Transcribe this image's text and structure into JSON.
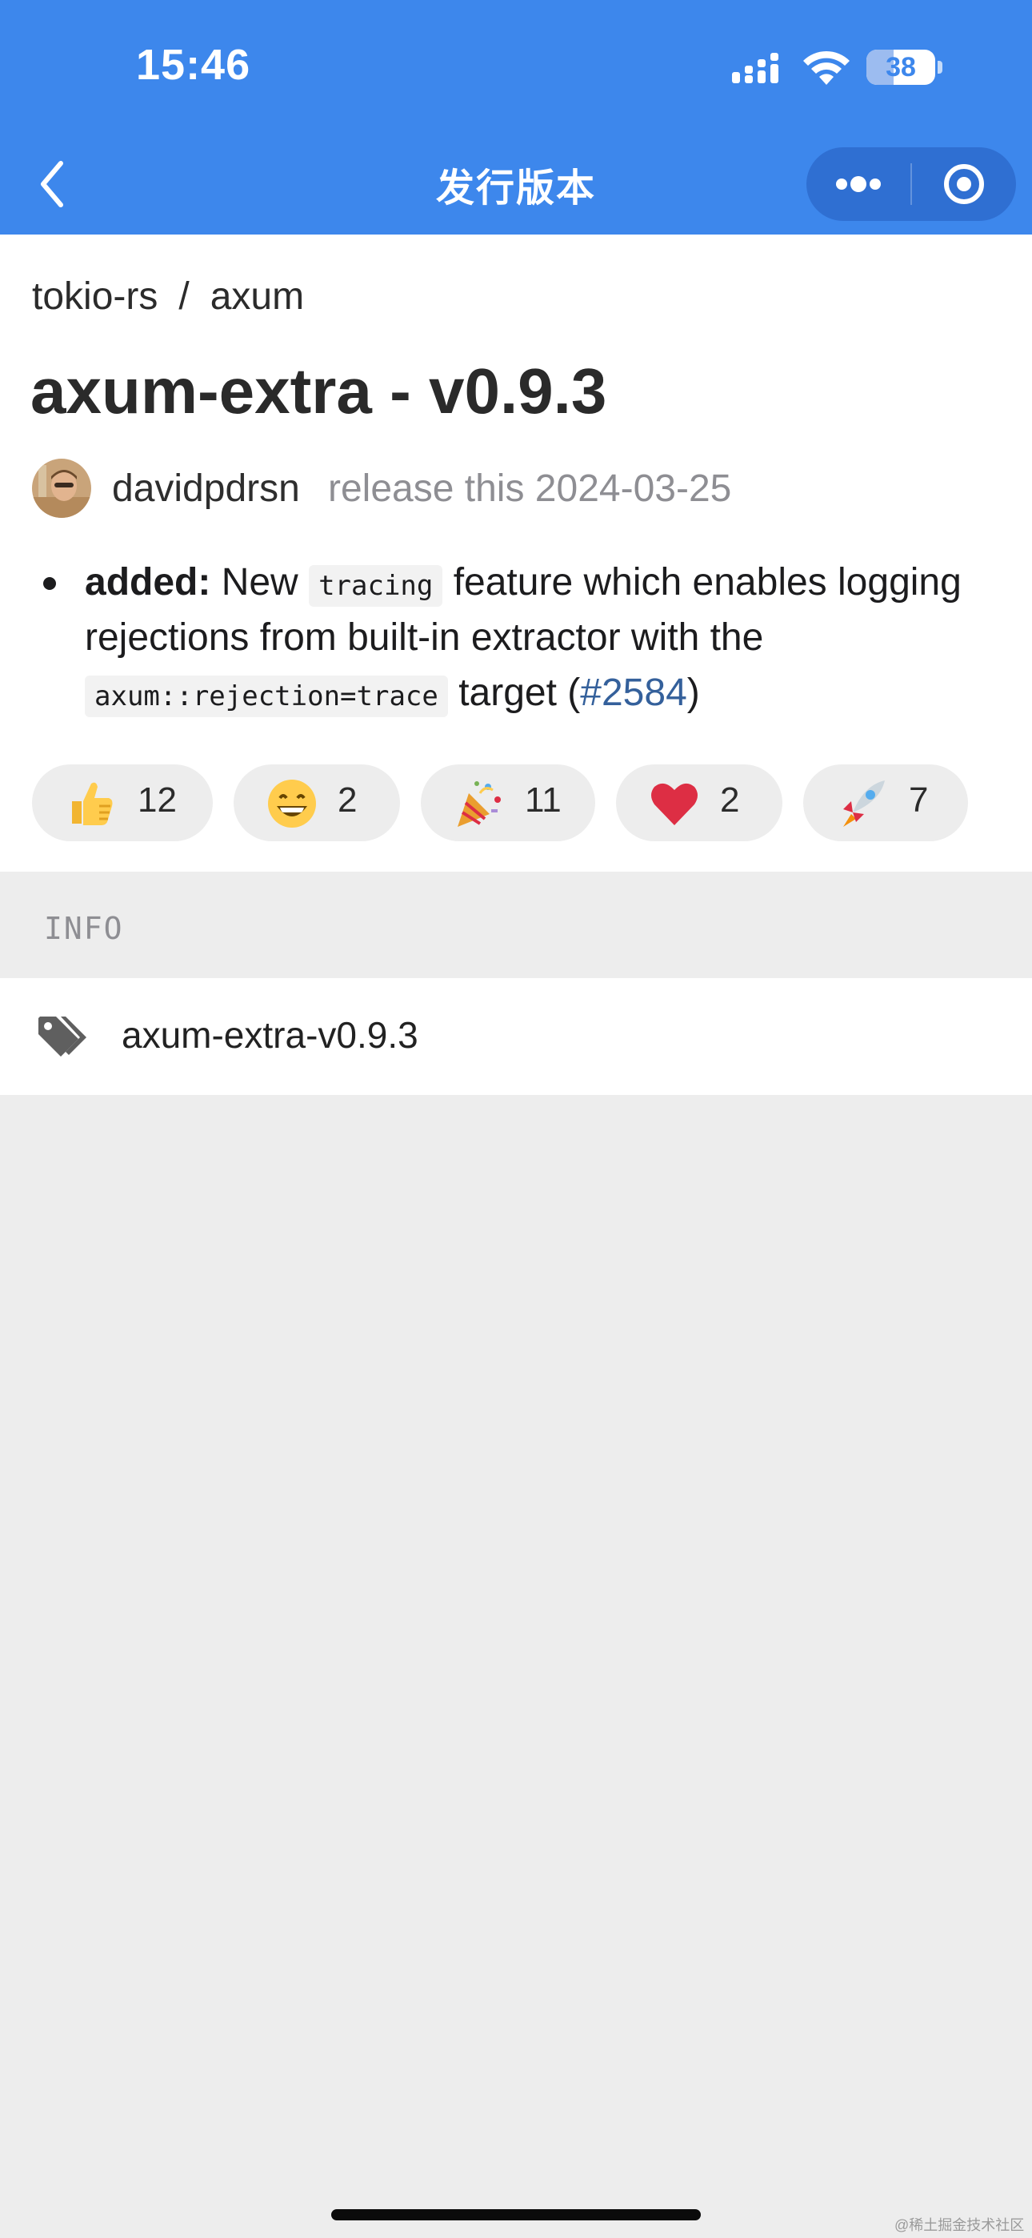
{
  "status_bar": {
    "time": "15:46",
    "battery_level": "38"
  },
  "nav": {
    "title": "发行版本"
  },
  "breadcrumb": {
    "owner": "tokio-rs",
    "separator": "/",
    "repo": "axum"
  },
  "release": {
    "title": "axum-extra - v0.9.3",
    "author": "davidpdrsn",
    "meta": "release this 2024-03-25"
  },
  "notes": {
    "label": "added:",
    "part1": "New",
    "code1": "tracing",
    "part2": "feature which enables logging",
    "line2": "rejections from built-in extractor with the",
    "code2": "axum::rejection=trace",
    "part3": "target (",
    "link": "#2584",
    "part4": ")"
  },
  "reactions": [
    {
      "icon": "thumbs-up",
      "count": "12"
    },
    {
      "icon": "grinning-face",
      "count": "2"
    },
    {
      "icon": "party-popper",
      "count": "11"
    },
    {
      "icon": "red-heart",
      "count": "2"
    },
    {
      "icon": "rocket",
      "count": "7"
    }
  ],
  "info": {
    "section_label": "INFO",
    "tag_icon": "tags",
    "tag": "axum-extra-v0.9.3"
  },
  "watermark": "@稀土掘金技术社区",
  "colors": {
    "header": "#3d87ec",
    "background": "#ededed",
    "link": "#34609b"
  }
}
